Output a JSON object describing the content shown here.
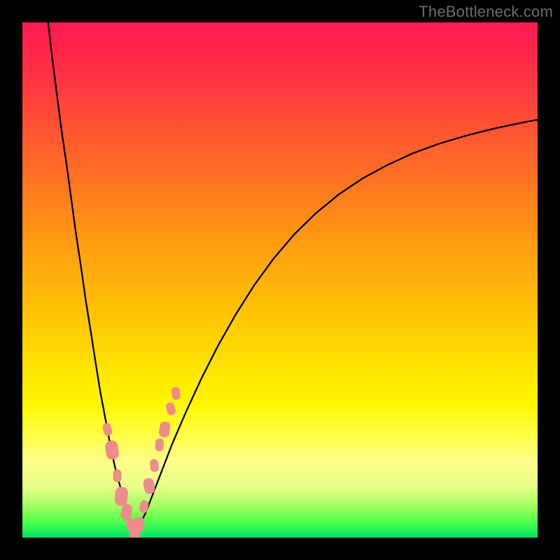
{
  "watermark": "TheBottleneck.com",
  "colors": {
    "frame": "#000000",
    "curve": "#000000",
    "marker": "#ef8b8b",
    "gradient_top": "#ff1a52",
    "gradient_bottom": "#00e66a"
  },
  "chart_data": {
    "type": "line",
    "title": "",
    "xlabel": "",
    "ylabel": "",
    "xlim": [
      0,
      100
    ],
    "ylim": [
      0,
      100
    ],
    "grid": false,
    "curve_note": "approximate |1 - k/x| bottleneck-style curve, valley at component match",
    "series": [
      {
        "name": "bottleneck-curve-left",
        "x": [
          5.0,
          5.8,
          6.7,
          7.6,
          8.6,
          9.5,
          10.4,
          11.4,
          12.3,
          13.3,
          14.2,
          15.1,
          16.1,
          17.0,
          17.9,
          18.9,
          19.8,
          20.8,
          21.7
        ],
        "values": [
          100.0,
          93.0,
          86.0,
          79.0,
          72.2,
          65.6,
          59.0,
          52.4,
          46.0,
          39.8,
          34.0,
          28.4,
          23.1,
          18.3,
          14.0,
          10.2,
          7.0,
          3.0,
          0.2
        ]
      },
      {
        "name": "bottleneck-curve-right",
        "x": [
          21.7,
          24.0,
          26.5,
          29.0,
          31.8,
          34.8,
          38.0,
          41.4,
          45.0,
          48.8,
          52.8,
          57.0,
          61.4,
          66.0,
          70.8,
          75.8,
          81.0,
          86.4,
          92.0,
          97.8,
          100.0
        ],
        "values": [
          0.2,
          5.0,
          11.5,
          18.0,
          24.5,
          31.0,
          37.3,
          43.3,
          49.0,
          54.2,
          58.9,
          63.0,
          66.6,
          69.7,
          72.3,
          74.6,
          76.5,
          78.1,
          79.5,
          80.7,
          81.1
        ]
      }
    ],
    "markers": {
      "name": "highlighted-points",
      "color": "#ef8b8b",
      "x": [
        16.5,
        17.4,
        18.4,
        19.2,
        20.2,
        21.0,
        21.8,
        22.6,
        23.6,
        24.6,
        25.6,
        26.6,
        27.6,
        28.8,
        29.8
      ],
      "values": [
        21.0,
        17.0,
        12.0,
        8.0,
        5.0,
        2.5,
        0.5,
        2.5,
        6.0,
        10.0,
        14.0,
        18.0,
        21.0,
        25.0,
        28.0
      ],
      "sizes": [
        2.0,
        3.0,
        2.0,
        3.0,
        2.5,
        2.0,
        2.5,
        2.5,
        2.0,
        2.5,
        2.0,
        2.0,
        2.5,
        2.0,
        2.0
      ]
    }
  }
}
